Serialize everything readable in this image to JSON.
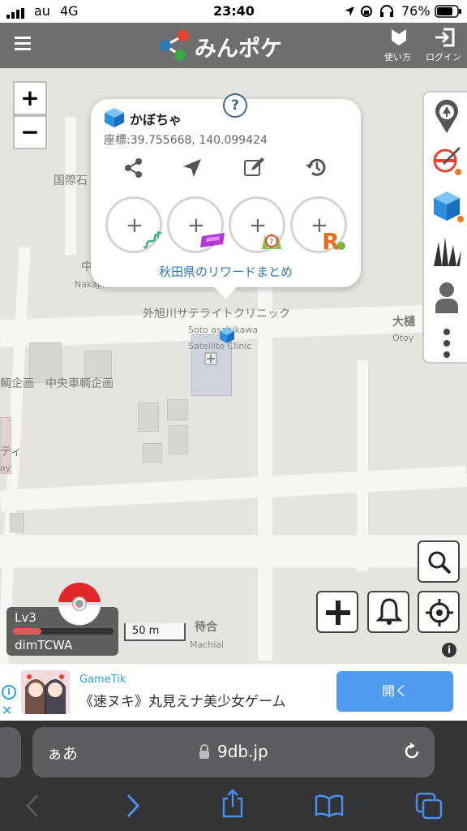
{
  "status_bar": {
    "carrier": "au",
    "network": "4G",
    "time": "23:40",
    "battery": "76%"
  },
  "header": {
    "menu_icon": "hamburger-menu-icon",
    "logo_text": "みんポケ",
    "howto_label": "使い方",
    "login_label": "ログイン"
  },
  "zoom": {
    "in_label": "+",
    "out_label": "−"
  },
  "popup": {
    "title": "かぼちゃ",
    "coords": "座標:39.755668, 140.099424",
    "help_label": "?",
    "actions": [
      "share-icon",
      "navigate-icon",
      "edit-icon",
      "history-icon"
    ],
    "reward_link": "秋田県のリワードまとめ"
  },
  "map_labels": {
    "clinic_jp": "外旭川サテライトクリニック",
    "clinic_en1": "Soto asahikawa",
    "clinic_en2": "Satellite Clinic",
    "kokusai": "国際石",
    "naka": "中",
    "nakajima": "Nakajima",
    "ohi": "大樋",
    "otoy": "Otoy",
    "chuo": "中央車輌企画",
    "kikaku": "輌企画",
    "machiai_jp": "待合",
    "machiai_en": "Machiai",
    "ti": "ティ",
    "ay": "ay"
  },
  "scale": {
    "label": "50 m"
  },
  "player": {
    "level": "Lv3",
    "name": "dimTCWA",
    "exp_fraction": 0.28
  },
  "ad": {
    "brand": "GameTik",
    "title": "《速ヌキ》丸見えナ美少女ゲーム",
    "cta": "開く"
  },
  "safari": {
    "aa_label": "ぁあ",
    "url": "9db.jp"
  },
  "colors": {
    "header": "#6e6e6e",
    "link": "#2f7ab8",
    "ad_button": "#4e9bf0",
    "cube": "#2e8ee0"
  }
}
